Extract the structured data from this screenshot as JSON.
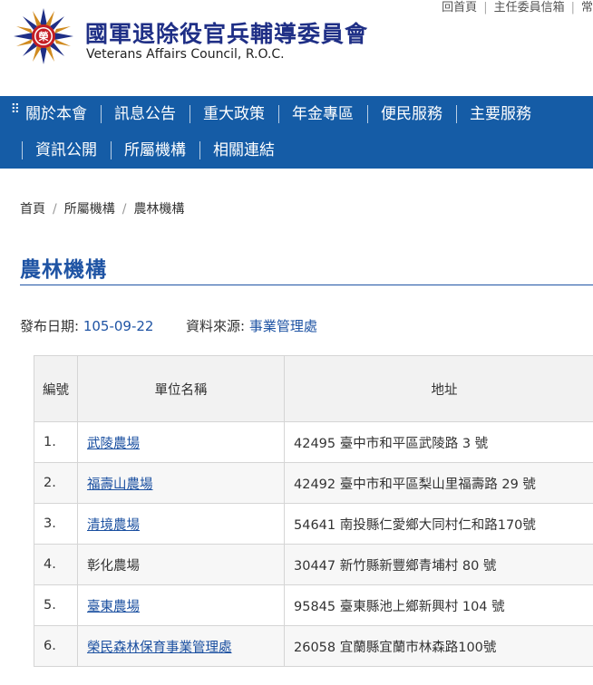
{
  "top_links": [
    "回首頁",
    "主任委員信箱",
    "常"
  ],
  "brand": {
    "name_cn": "國軍退除役官兵輔導委員會",
    "name_en": "Veterans Affairs Council, R.O.C.",
    "emblem_char": "榮"
  },
  "nav": {
    "row1": [
      "關於本會",
      "訊息公告",
      "重大政策",
      "年金專區",
      "便民服務",
      "主要服務"
    ],
    "row2": [
      "資訊公開",
      "所屬機構",
      "相關連結"
    ]
  },
  "breadcrumb": [
    "首頁",
    "所屬機構",
    "農林機構"
  ],
  "page": {
    "title": "農林機構",
    "publish_label": "發布日期:",
    "publish_date": "105-09-22",
    "source_label": "資料來源:",
    "source_value": "事業管理處"
  },
  "table": {
    "headers": [
      "編號",
      "單位名稱",
      "地址"
    ],
    "rows": [
      {
        "num": "1.",
        "name": "武陵農場",
        "link": true,
        "address": "42495 臺中市和平區武陵路 3 號"
      },
      {
        "num": "2.",
        "name": "福壽山農場",
        "link": true,
        "address": "42492 臺中市和平區梨山里福壽路 29 號"
      },
      {
        "num": "3.",
        "name": "清境農場",
        "link": true,
        "address": "54641 南投縣仁愛鄉大同村仁和路170號"
      },
      {
        "num": "4.",
        "name": "彰化農場",
        "link": false,
        "address": "30447 新竹縣新豐鄉青埔村 80 號"
      },
      {
        "num": "5.",
        "name": "臺東農場",
        "link": true,
        "address": "95845 臺東縣池上鄉新興村 104 號"
      },
      {
        "num": "6.",
        "name": "榮民森林保育事業管理處",
        "link": true,
        "address": "26058 宜蘭縣宜蘭市林森路100號"
      }
    ]
  },
  "colors": {
    "nav_bg": "#155ca6",
    "brand_blue": "#1f2f86",
    "accent": "#1f54a4"
  }
}
